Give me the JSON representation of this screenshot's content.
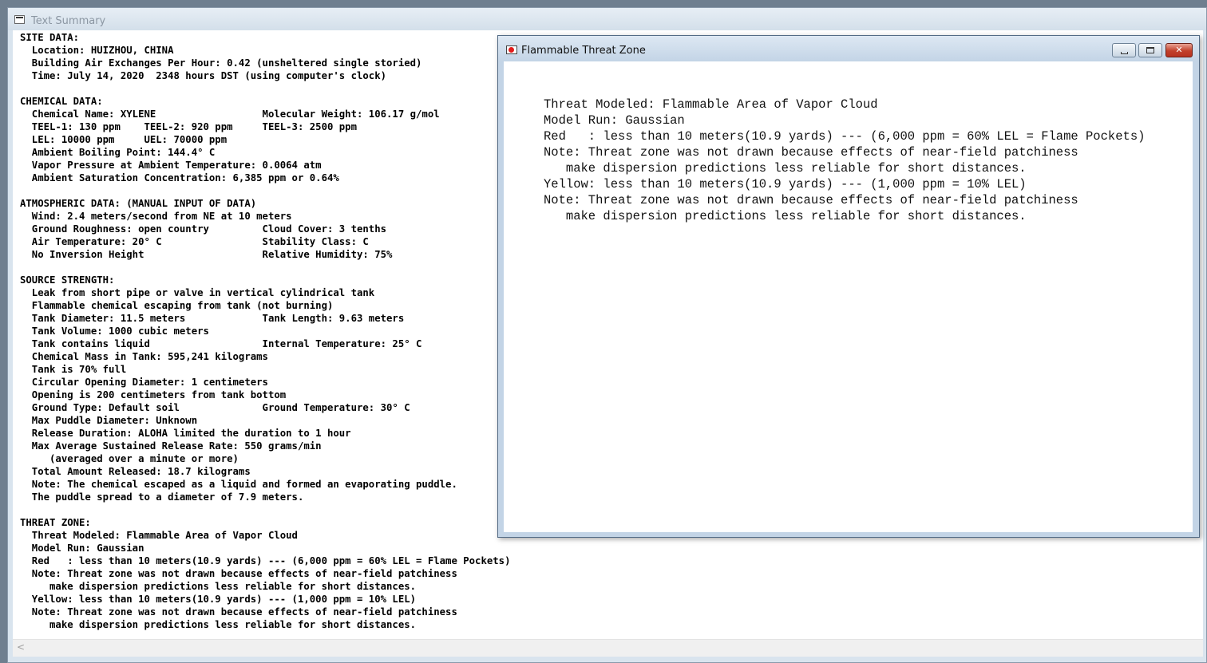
{
  "main_window": {
    "title": "Text Summary",
    "lines": [
      "SITE DATA:",
      "  Location: HUIZHOU, CHINA",
      "  Building Air Exchanges Per Hour: 0.42 (unsheltered single storied)",
      "  Time: July 14, 2020  2348 hours DST (using computer's clock)",
      "",
      "CHEMICAL DATA:",
      "  Chemical Name: XYLENE                  Molecular Weight: 106.17 g/mol",
      "  TEEL-1: 130 ppm    TEEL-2: 920 ppm     TEEL-3: 2500 ppm",
      "  LEL: 10000 ppm     UEL: 70000 ppm",
      "  Ambient Boiling Point: 144.4° C",
      "  Vapor Pressure at Ambient Temperature: 0.0064 atm",
      "  Ambient Saturation Concentration: 6,385 ppm or 0.64%",
      "",
      "ATMOSPHERIC DATA: (MANUAL INPUT OF DATA)",
      "  Wind: 2.4 meters/second from NE at 10 meters",
      "  Ground Roughness: open country         Cloud Cover: 3 tenths",
      "  Air Temperature: 20° C                 Stability Class: C",
      "  No Inversion Height                    Relative Humidity: 75%",
      "",
      "SOURCE STRENGTH:",
      "  Leak from short pipe or valve in vertical cylindrical tank",
      "  Flammable chemical escaping from tank (not burning)",
      "  Tank Diameter: 11.5 meters             Tank Length: 9.63 meters",
      "  Tank Volume: 1000 cubic meters",
      "  Tank contains liquid                   Internal Temperature: 25° C",
      "  Chemical Mass in Tank: 595,241 kilograms",
      "  Tank is 70% full",
      "  Circular Opening Diameter: 1 centimeters",
      "  Opening is 200 centimeters from tank bottom",
      "  Ground Type: Default soil              Ground Temperature: 30° C",
      "  Max Puddle Diameter: Unknown",
      "  Release Duration: ALOHA limited the duration to 1 hour",
      "  Max Average Sustained Release Rate: 550 grams/min",
      "     (averaged over a minute or more)",
      "  Total Amount Released: 18.7 kilograms",
      "  Note: The chemical escaped as a liquid and formed an evaporating puddle.",
      "  The puddle spread to a diameter of 7.9 meters.",
      "",
      "THREAT ZONE:",
      "  Threat Modeled: Flammable Area of Vapor Cloud",
      "  Model Run: Gaussian",
      "  Red   : less than 10 meters(10.9 yards) --- (6,000 ppm = 60% LEL = Flame Pockets)",
      "  Note: Threat zone was not drawn because effects of near-field patchiness",
      "     make dispersion predictions less reliable for short distances.",
      "  Yellow: less than 10 meters(10.9 yards) --- (1,000 ppm = 10% LEL)",
      "  Note: Threat zone was not drawn because effects of near-field patchiness",
      "     make dispersion predictions less reliable for short distances."
    ],
    "scroll_left_glyph": "<"
  },
  "threat_window": {
    "title": "Flammable Threat Zone",
    "lines": [
      "Threat Modeled: Flammable Area of Vapor Cloud",
      "Model Run: Gaussian",
      "Red   : less than 10 meters(10.9 yards) --- (6,000 ppm = 60% LEL = Flame Pockets)",
      "Note: Threat zone was not drawn because effects of near-field patchiness",
      "   make dispersion predictions less reliable for short distances.",
      "Yellow: less than 10 meters(10.9 yards) --- (1,000 ppm = 10% LEL)",
      "Note: Threat zone was not drawn because effects of near-field patchiness",
      "   make dispersion predictions less reliable for short distances."
    ],
    "close_glyph": "✕"
  },
  "icons": {
    "main_app": "document-window-icon",
    "threat_window": "threat-zone-icon"
  },
  "colors": {
    "threat_icon_red": "#e31b1b",
    "close_button": "#c2402b"
  }
}
